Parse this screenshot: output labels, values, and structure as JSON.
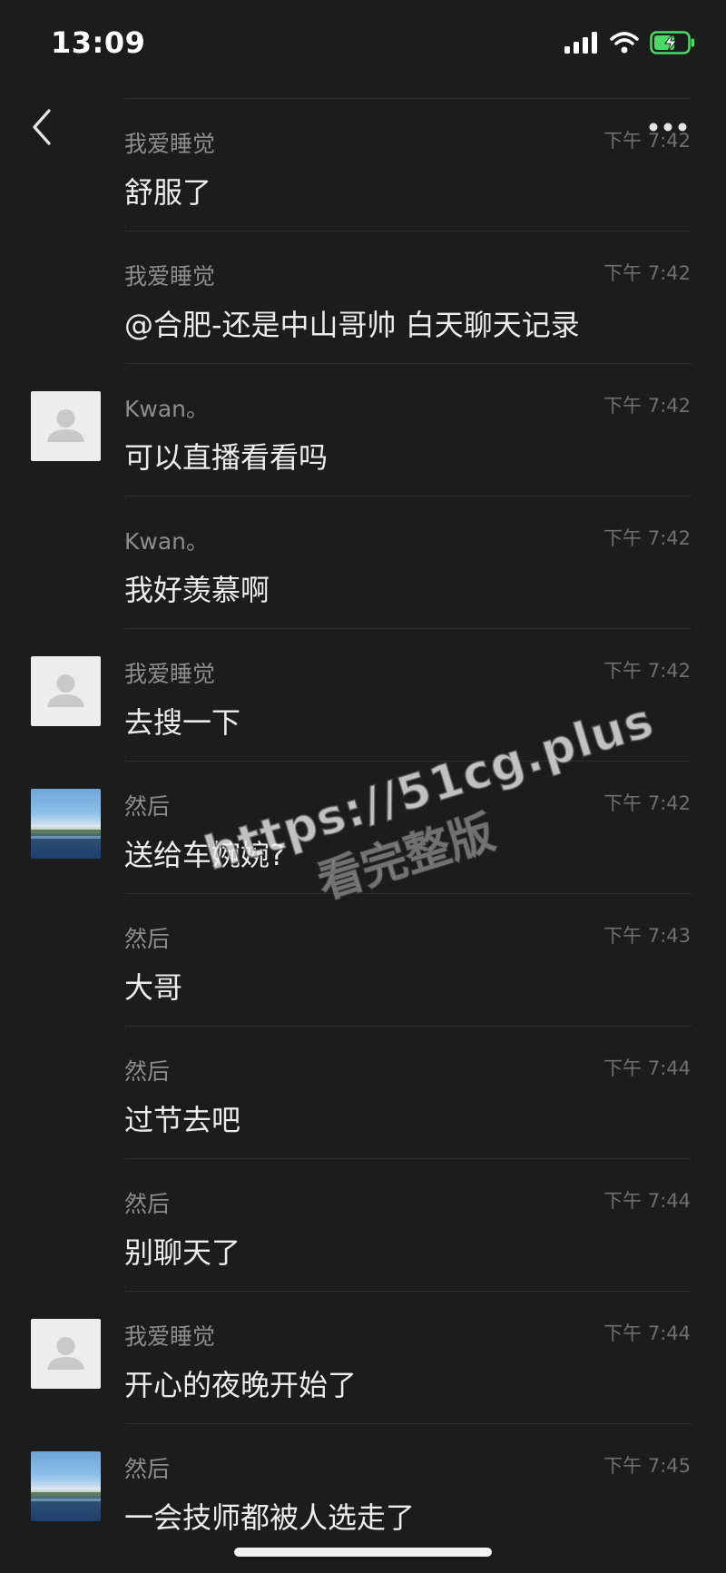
{
  "status_bar": {
    "time": "13:09",
    "signal_icon": "signal-bars-icon",
    "wifi_icon": "wifi-icon",
    "battery_icon": "battery-charging-icon",
    "battery_color": "#4cd964"
  },
  "nav": {
    "back_icon": "chevron-left-icon",
    "more_icon": "more-dots-icon"
  },
  "messages": [
    {
      "sender": "我爱睡觉",
      "time": "下午 7:42",
      "text": "舒服了",
      "avatar": "none"
    },
    {
      "sender": "我爱睡觉",
      "time": "下午 7:42",
      "text": "@合肥-还是中山哥帅 白天聊天记录",
      "avatar": "none"
    },
    {
      "sender": "Kwan。",
      "time": "下午 7:42",
      "text": "可以直播看看吗",
      "avatar": "default"
    },
    {
      "sender": "Kwan。",
      "time": "下午 7:42",
      "text": "我好羡慕啊",
      "avatar": "none"
    },
    {
      "sender": "我爱睡觉",
      "time": "下午 7:42",
      "text": "去搜一下",
      "avatar": "default"
    },
    {
      "sender": "然后",
      "time": "下午 7:42",
      "text": "送给车婉婉?",
      "avatar": "photo"
    },
    {
      "sender": "然后",
      "time": "下午 7:43",
      "text": "大哥",
      "avatar": "none"
    },
    {
      "sender": "然后",
      "time": "下午 7:44",
      "text": "过节去吧",
      "avatar": "none"
    },
    {
      "sender": "然后",
      "time": "下午 7:44",
      "text": "别聊天了",
      "avatar": "none"
    },
    {
      "sender": "我爱睡觉",
      "time": "下午 7:44",
      "text": "开心的夜晚开始了",
      "avatar": "default"
    },
    {
      "sender": "然后",
      "time": "下午 7:45",
      "text": "一会技师都被人选走了",
      "avatar": "photo"
    }
  ],
  "watermark": {
    "line1": "https://51cg.plus",
    "line2": "看完整版"
  }
}
